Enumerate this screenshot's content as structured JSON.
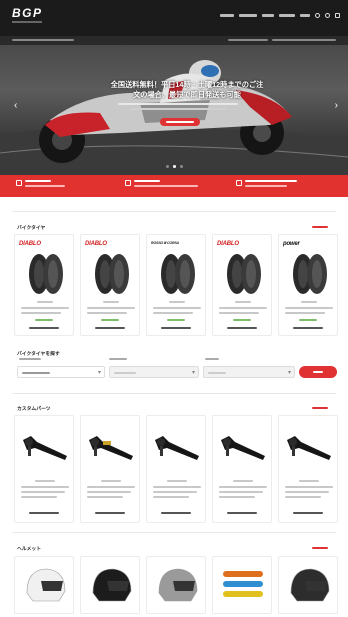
{
  "header": {
    "logo_main": "BGP",
    "nav_count": 7
  },
  "hero": {
    "headline_line1": "全国送料無料！平日14時・土曜12時までのご注",
    "headline_line2": "文の場合、最短で即日発送も可能",
    "slides_total": 3,
    "slide_active": 2
  },
  "sections": {
    "tires": {
      "title": "バイクタイヤ"
    },
    "search": {
      "title": "バイクタイヤを探す"
    },
    "parts": {
      "title": "カスタムパーツ"
    },
    "helmets": {
      "title": "ヘルメット"
    }
  },
  "tire_brands": [
    {
      "name": "DIABLO",
      "color": "#d32020"
    },
    {
      "name": "DIABLO",
      "color": "#d32020"
    },
    {
      "name": "ROSSO III CORSA",
      "color": "#222222"
    },
    {
      "name": "DIABLO",
      "color": "#d32020"
    },
    {
      "name": "power",
      "color": "#111111"
    }
  ],
  "colors": {
    "accent": "#e03232",
    "header": "#1b1b1b",
    "band": "#e2322f"
  },
  "icons": {
    "prev": "‹",
    "next": "›",
    "caret": "▾"
  }
}
